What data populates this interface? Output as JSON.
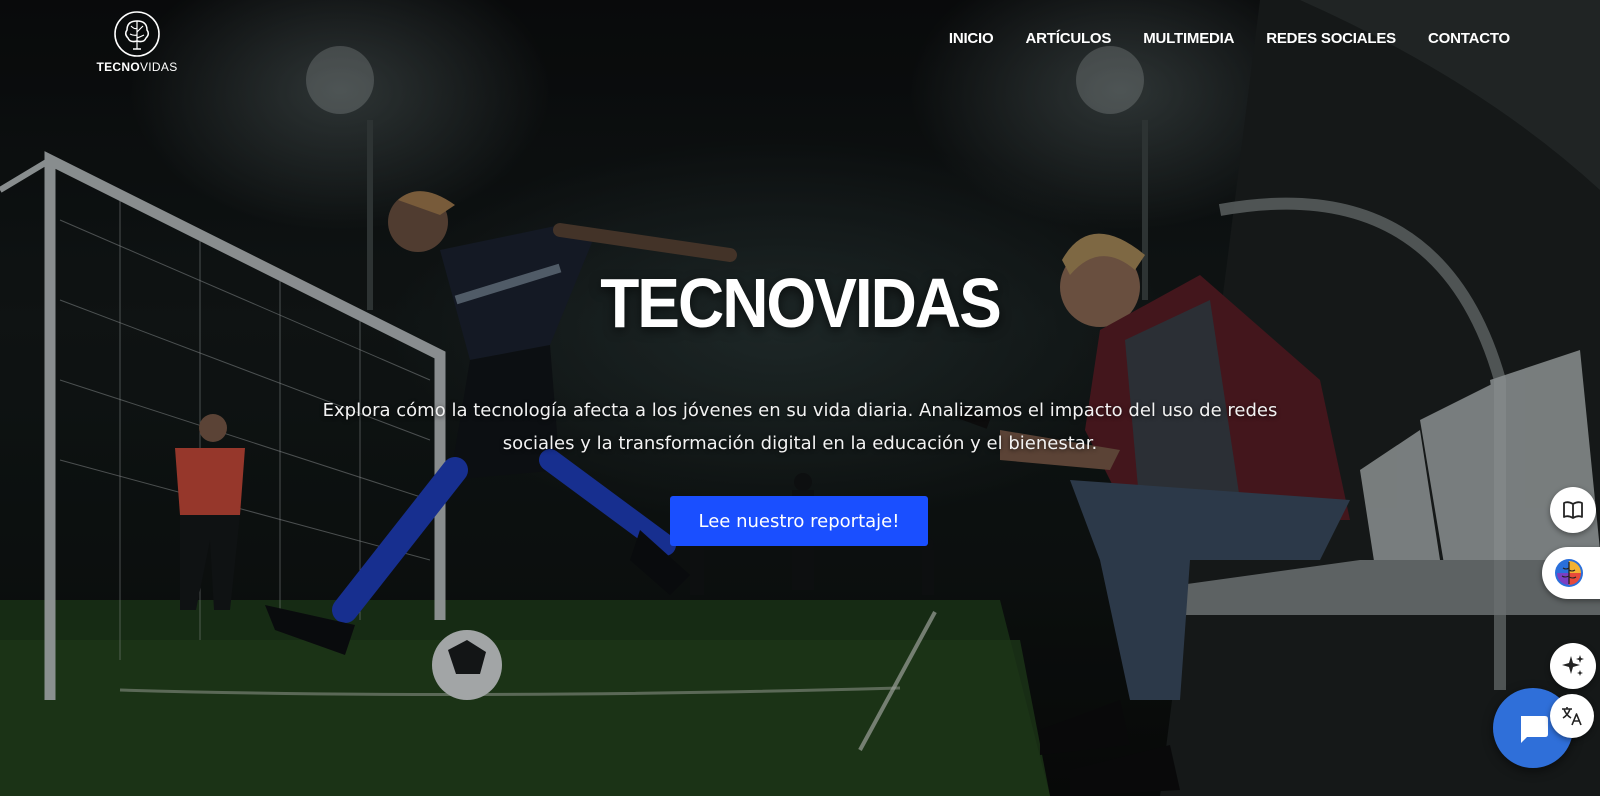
{
  "brand": {
    "prefix": "TECNO",
    "suffix": "VIDAS"
  },
  "nav": {
    "items": [
      {
        "label": "INICIO"
      },
      {
        "label": "ARTÍCULOS"
      },
      {
        "label": "MULTIMEDIA"
      },
      {
        "label": "REDES SOCIALES"
      },
      {
        "label": "CONTACTO"
      }
    ]
  },
  "hero": {
    "title": "TECNOVIDAS",
    "description": "Explora cómo la tecnología afecta a los jóvenes en su vida diaria. Analizamos el impacto del uso de redes sociales y la transformación digital en la educación y el bienestar.",
    "cta_label": "Lee nuestro reportaje!"
  },
  "colors": {
    "accent": "#1a4fff",
    "chat": "#2f6fd9"
  },
  "widgets": {
    "icons": [
      "book-icon",
      "brain-icon",
      "sparkle-icon",
      "translate-icon",
      "chat-icon"
    ]
  }
}
